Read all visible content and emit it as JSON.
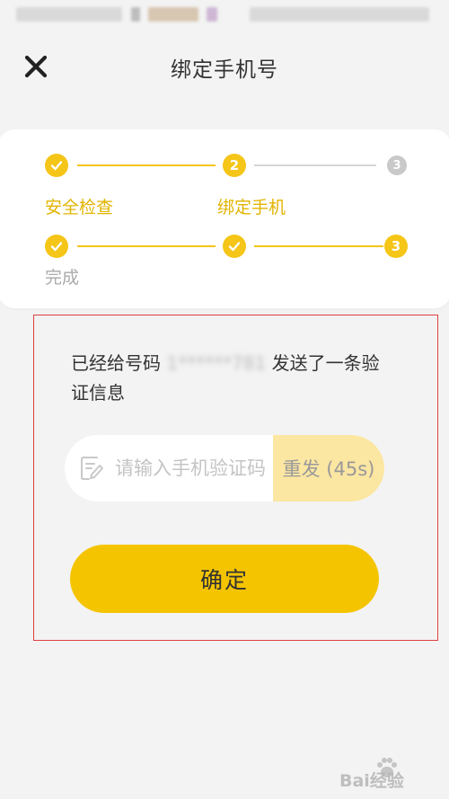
{
  "header": {
    "title": "绑定手机号",
    "close_icon": "close-icon"
  },
  "steps": {
    "row1": {
      "nodes": [
        {
          "state": "done",
          "icon": "check-icon",
          "label": "安全检查"
        },
        {
          "state": "active",
          "number": "2",
          "label": "绑定手机"
        },
        {
          "state": "pending",
          "number": "3"
        }
      ]
    },
    "row2": {
      "nodes": [
        {
          "state": "done",
          "icon": "check-icon",
          "label": "完成"
        },
        {
          "state": "done",
          "icon": "check-icon"
        },
        {
          "state": "active",
          "number": "3"
        }
      ]
    }
  },
  "verify": {
    "message_prefix": "已经给号码",
    "phone_masked": "1******781",
    "message_suffix": "发送了一条验证信息",
    "code_placeholder": "请输入手机验证码",
    "code_value": "",
    "resend_label": "重发 (45s)"
  },
  "confirm_label": "确定",
  "watermark_text": "Bai经验",
  "colors": {
    "accent": "#f5c400",
    "step_accent": "#f5c517",
    "resend_bg": "#fbe6a2",
    "highlight_border": "#e0403f"
  }
}
